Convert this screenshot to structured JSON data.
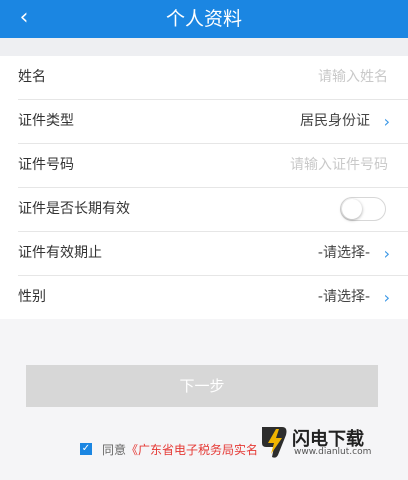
{
  "header": {
    "title": "个人资料",
    "back_icon": "chevron-left-icon"
  },
  "form": {
    "name_label": "姓名",
    "name_placeholder": "请输入姓名",
    "id_type_label": "证件类型",
    "id_type_value": "居民身份证",
    "id_number_label": "证件号码",
    "id_number_placeholder": "请输入证件号码",
    "long_term_label": "证件是否长期有效",
    "long_term_on": false,
    "expiry_label": "证件有效期止",
    "expiry_value": "-请选择-",
    "gender_label": "性别",
    "gender_value": "-请选择-"
  },
  "actions": {
    "next_label": "下一步"
  },
  "agreement": {
    "checked": true,
    "prefix": "同意",
    "link_text": "《广东省电子税务局实名"
  },
  "watermark": {
    "name": "闪电下载",
    "url": "www.dianlut.com"
  },
  "colors": {
    "brand_blue": "#1b86e2",
    "link_red": "#e53935"
  }
}
